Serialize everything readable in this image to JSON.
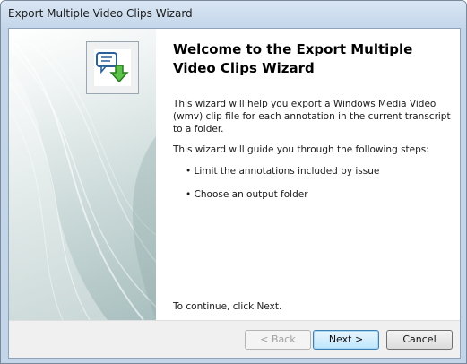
{
  "window": {
    "title": "Export Multiple Video Clips Wizard"
  },
  "welcome": {
    "heading": "Welcome to the Export Multiple Video Clips Wizard",
    "intro": "This wizard will help you export a Windows Media Video (wmv) clip file for each annotation in the current transcript to a folder.",
    "steps_intro": "This wizard will guide you through the following steps:",
    "steps": [
      "• Limit the annotations included by issue",
      "• Choose an output folder"
    ],
    "continue_text": "To continue, click Next."
  },
  "buttons": {
    "back": "< Back",
    "next": "Next >",
    "cancel": "Cancel"
  },
  "icon": "export-clip-icon"
}
